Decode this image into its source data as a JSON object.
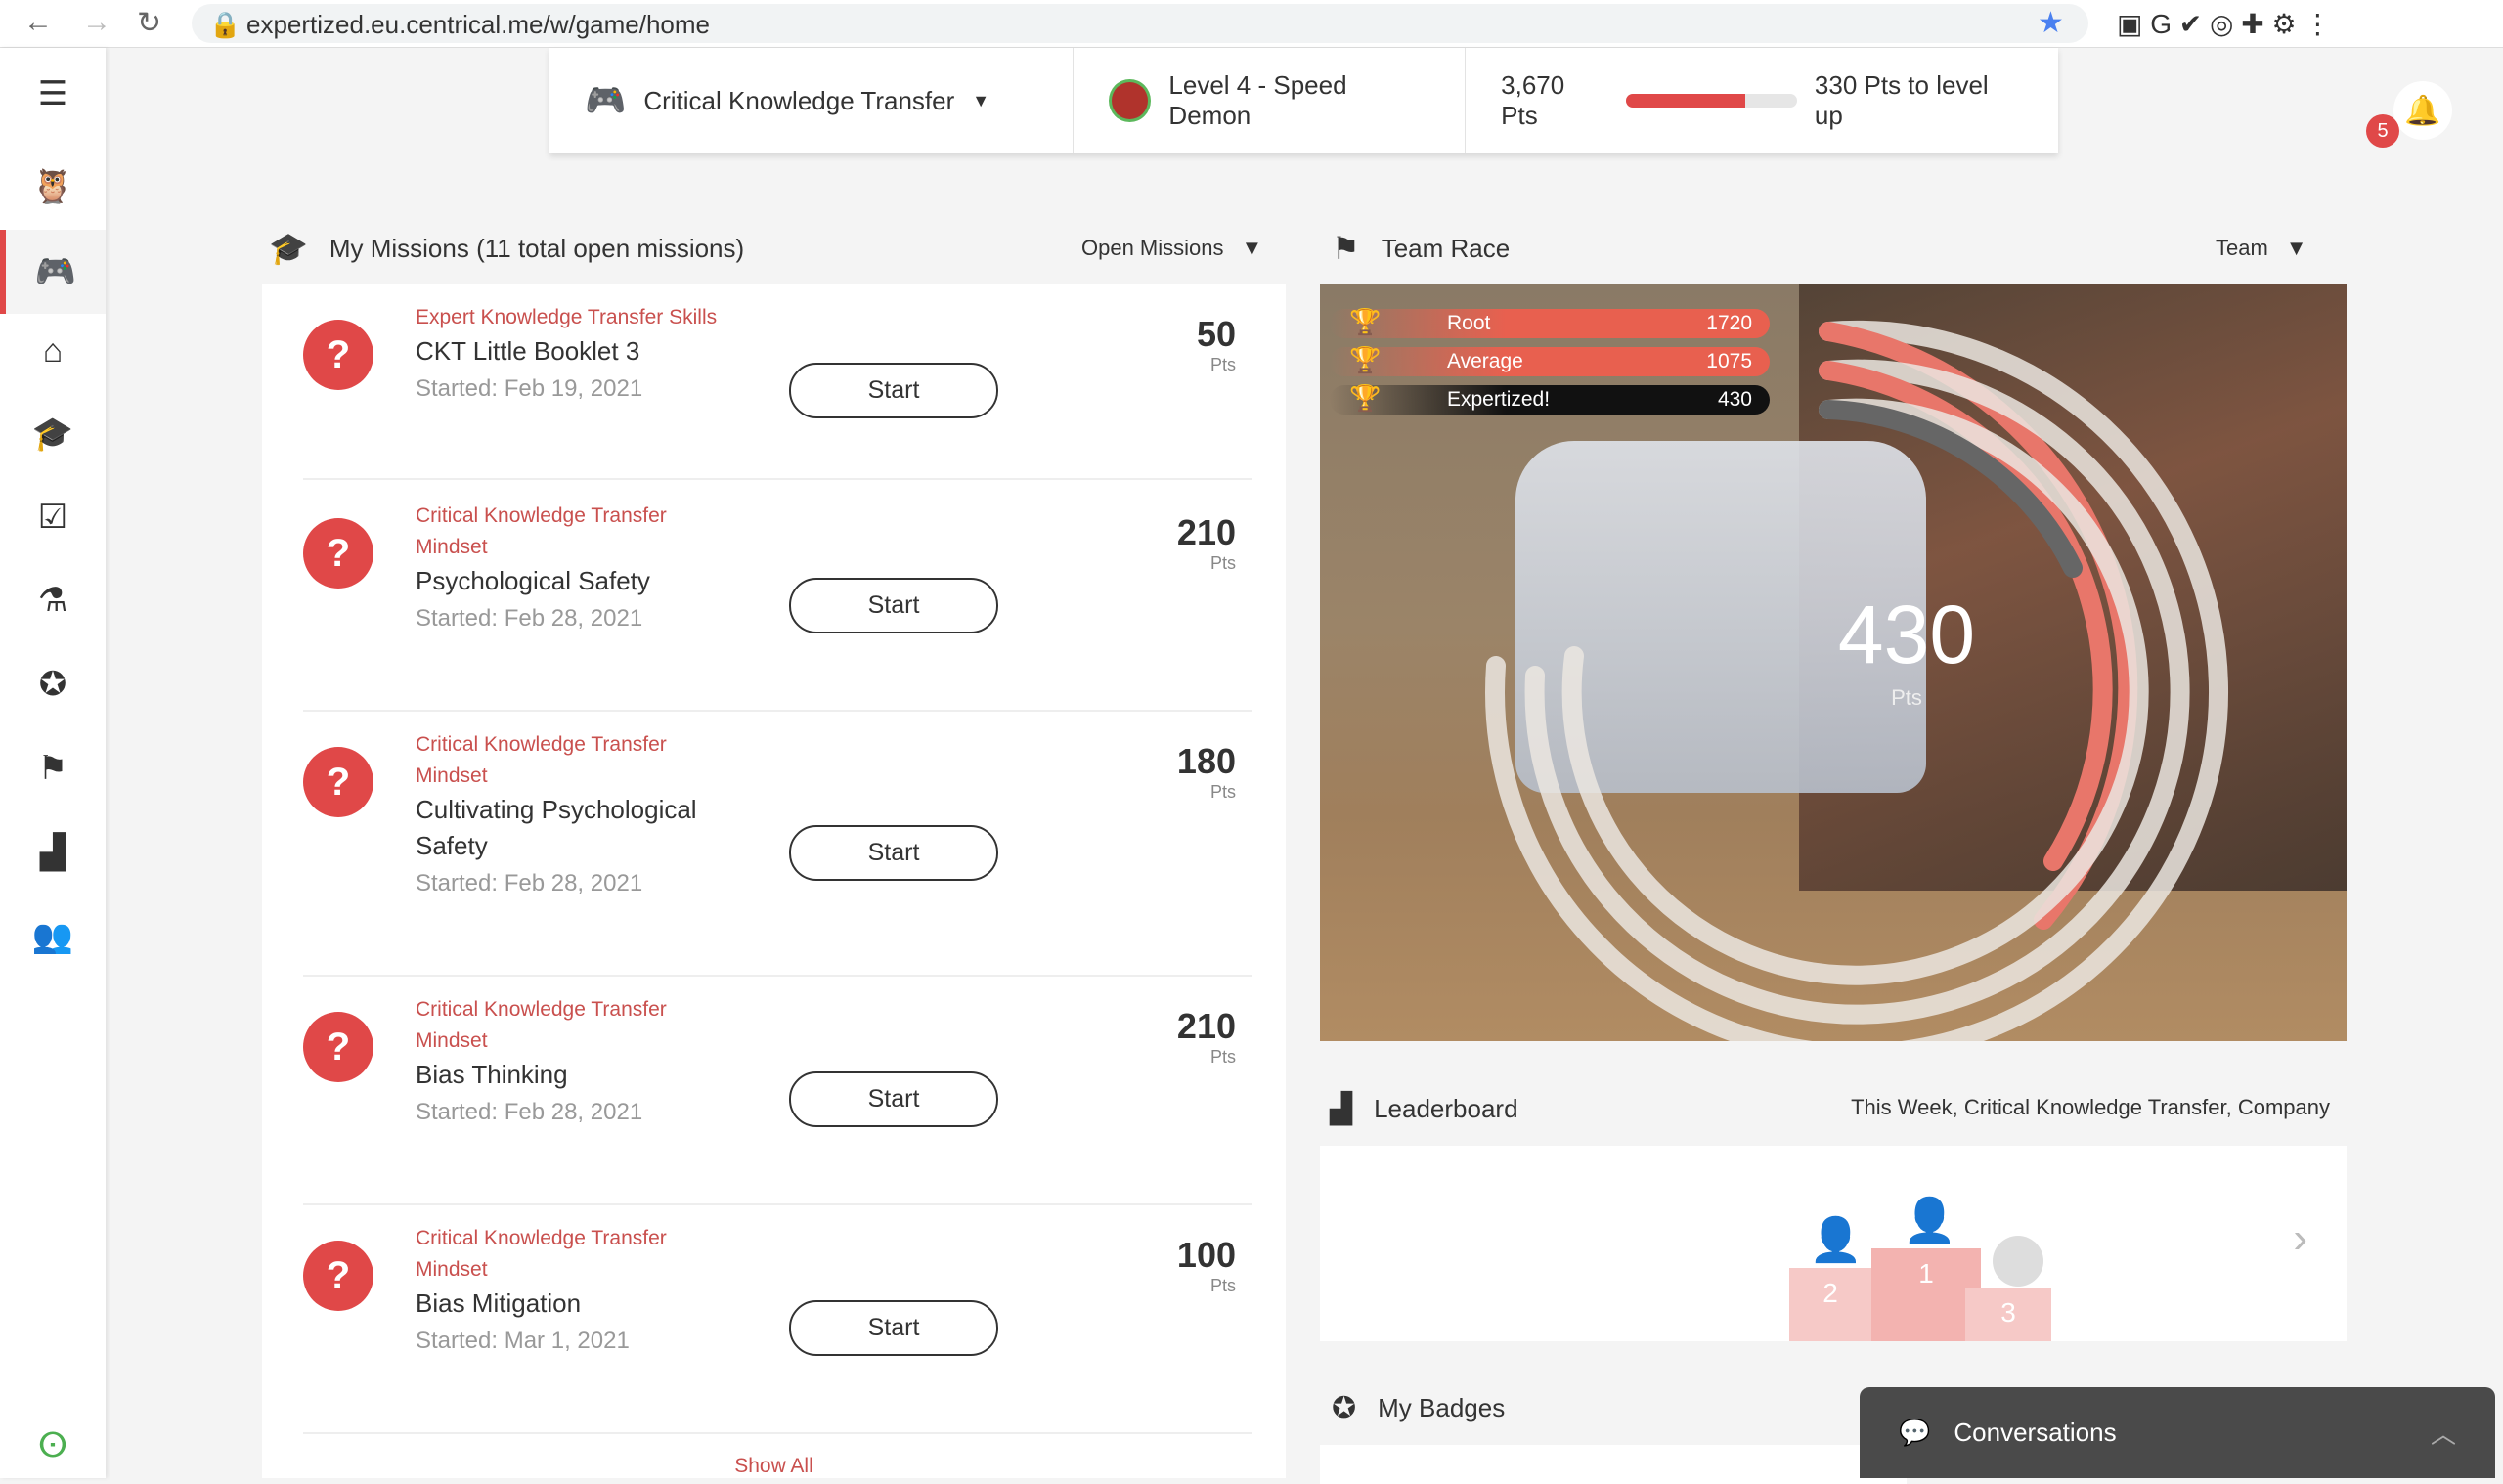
{
  "browser": {
    "url": "expertized.eu.centrical.me/w/game/home"
  },
  "top": {
    "game": "Critical Knowledge Transfer",
    "level": "Level 4 - Speed Demon",
    "points": "3,670 Pts",
    "progress_percent": 70,
    "to_level": "330 Pts to level up",
    "notifications": "5"
  },
  "missions": {
    "title": "My Missions (11 total open missions)",
    "filter": "Open Missions",
    "start_label": "Start",
    "pts_label": "Pts",
    "show_all": "Show All",
    "items": [
      {
        "category": "Expert Knowledge Transfer Skills",
        "title": "CKT Little Booklet 3",
        "started": "Started: Feb 19, 2021",
        "points": "50"
      },
      {
        "category": "Critical Knowledge Transfer Mindset",
        "title": "Psychological Safety",
        "started": "Started: Feb 28, 2021",
        "points": "210"
      },
      {
        "category": "Critical Knowledge Transfer Mindset",
        "title": "Cultivating Psychological Safety",
        "started": "Started: Feb 28, 2021",
        "points": "180"
      },
      {
        "category": "Critical Knowledge Transfer Mindset",
        "title": "Bias Thinking",
        "started": "Started: Feb 28, 2021",
        "points": "210"
      },
      {
        "category": "Critical Knowledge Transfer Mindset",
        "title": "Bias Mitigation",
        "started": "Started: Mar 1, 2021",
        "points": "100"
      }
    ]
  },
  "race": {
    "title": "Team Race",
    "filter": "Team",
    "score": "430",
    "score_unit": "Pts",
    "rows": [
      {
        "name": "Root",
        "value": "1720"
      },
      {
        "name": "Average",
        "value": "1075"
      },
      {
        "name": "Expertized!",
        "value": "430"
      }
    ]
  },
  "leaderboard": {
    "title": "Leaderboard",
    "filter": "This Week, Critical Knowledge Transfer, Company",
    "places": [
      "2",
      "1",
      "3"
    ]
  },
  "badges": {
    "title": "My Badges"
  },
  "conversations": {
    "label": "Conversations"
  },
  "colors": {
    "accent": "#e04848"
  }
}
